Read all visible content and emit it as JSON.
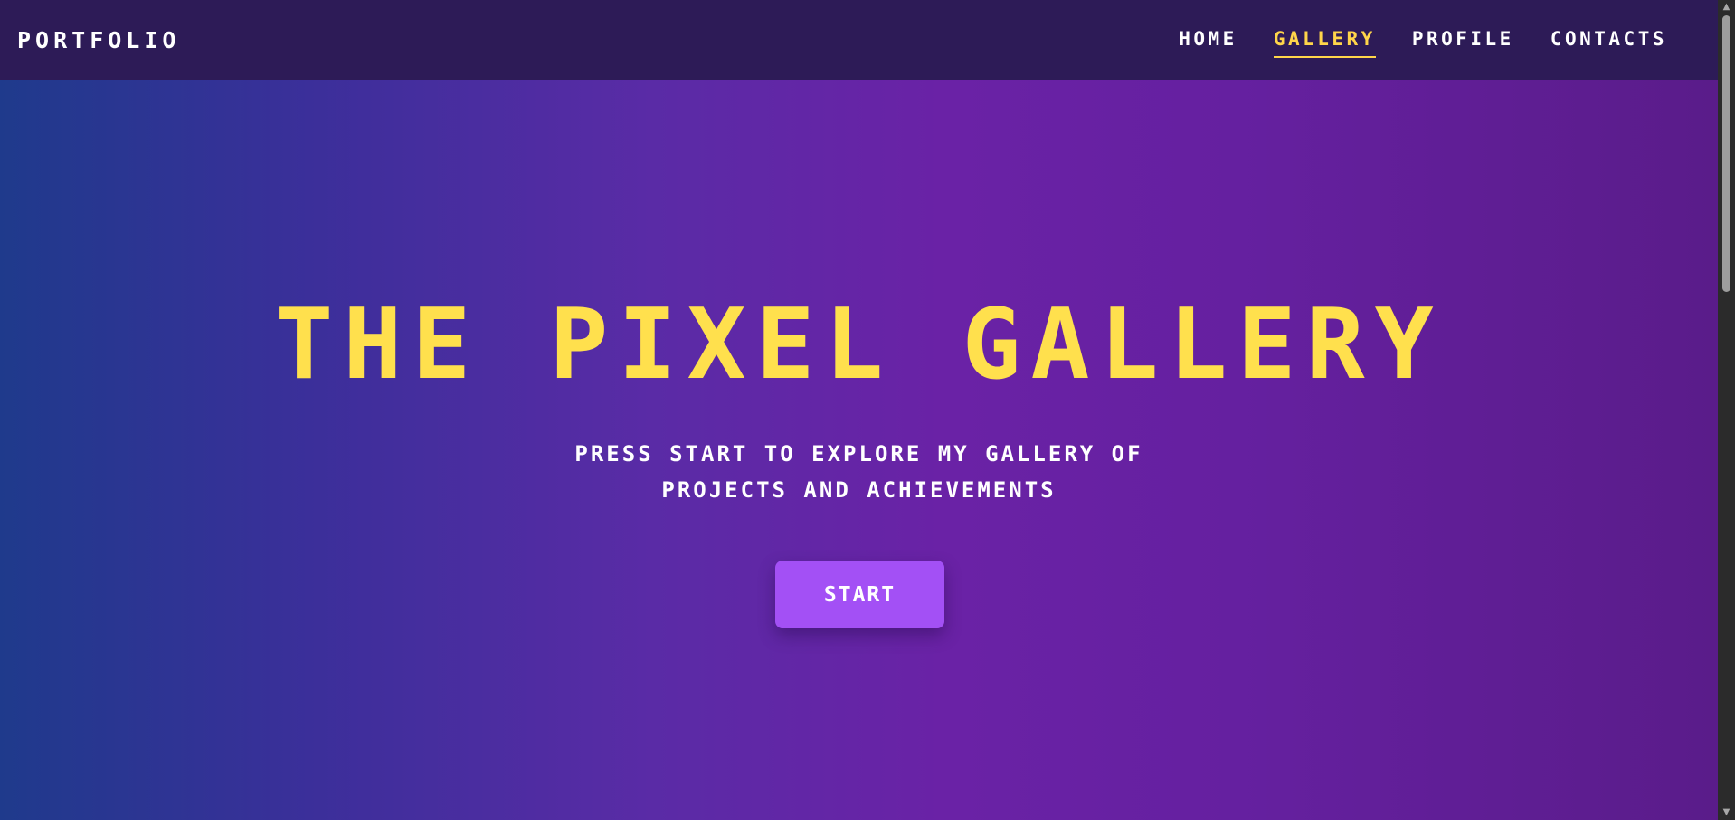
{
  "header": {
    "brand": "PORTFOLIO",
    "nav": [
      {
        "label": "HOME",
        "active": false
      },
      {
        "label": "GALLERY",
        "active": true
      },
      {
        "label": "PROFILE",
        "active": false
      },
      {
        "label": "CONTACTS",
        "active": false
      }
    ]
  },
  "hero": {
    "title": "THE PIXEL GALLERY",
    "subtitle_line1": "PRESS START TO EXPLORE MY GALLERY OF",
    "subtitle_line2": "PROJECTS AND ACHIEVEMENTS",
    "start_label": "START"
  },
  "scrollbar": {
    "up_glyph": "▲",
    "down_glyph": "▼"
  },
  "colors": {
    "nav_background": "#2d1b57",
    "accent_yellow": "#ffd54a",
    "title_yellow": "#ffe04d",
    "button_purple": "#a350f5",
    "gradient_start": "#1f3a8c",
    "gradient_mid": "#6a22a6",
    "gradient_end": "#5a1c8a"
  }
}
